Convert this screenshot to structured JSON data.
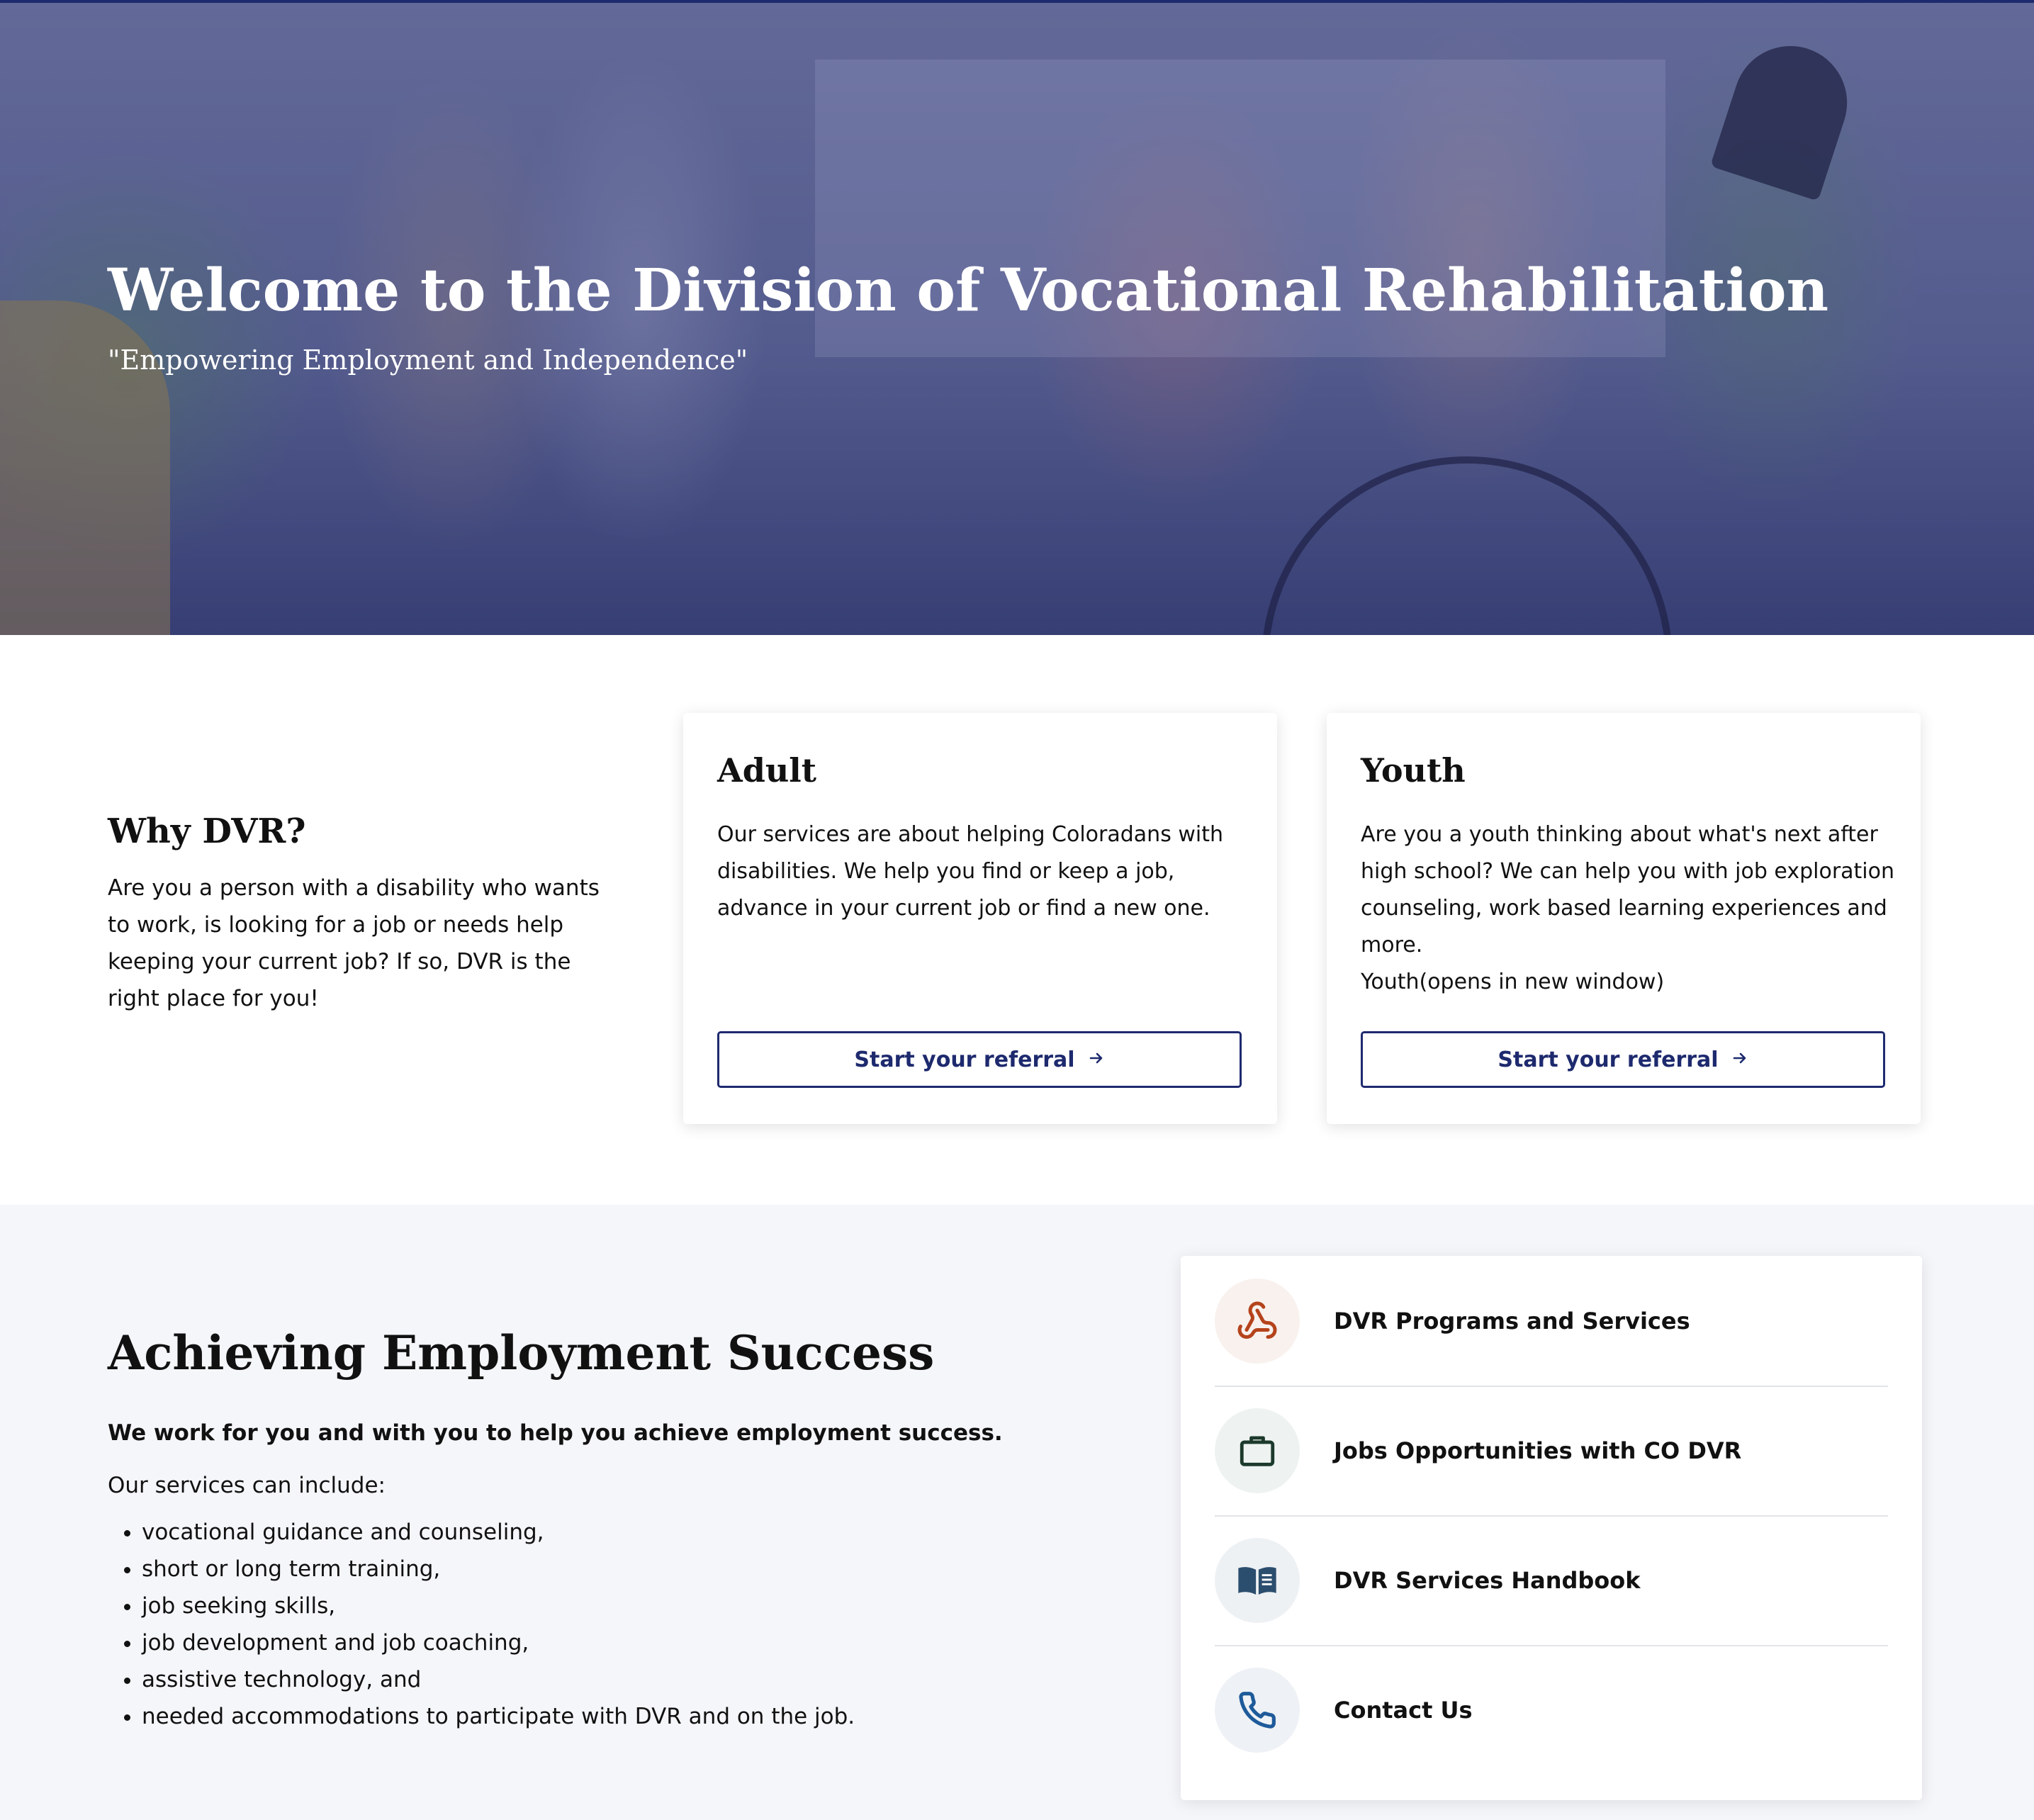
{
  "hero": {
    "title": "Welcome to the Division of Vocational Rehabilitation",
    "subtitle": "\"Empowering Employment and Independence\""
  },
  "why": {
    "heading": "Why DVR?",
    "text": "Are you a person with a disability who wants to work, is looking for a job or needs help keeping your current job? If so, DVR is the right place for you!"
  },
  "cards": [
    {
      "title": "Adult",
      "text": "Our services are about helping Coloradans with disabilities. We help you find or keep a job, advance in your current job or find a new one.",
      "button_label": "Start your referral"
    },
    {
      "title": "Youth",
      "text": "Are you a youth thinking about what's next after high school? We can help you with job exploration counseling, work based learning experiences and more.",
      "link_text": "Youth(opens in new window)",
      "button_label": "Start your referral"
    }
  ],
  "achieving": {
    "heading": "Achieving Employment Success",
    "lead": "We work for you and with you to help you achieve employment success.",
    "intro": "Our services can include:",
    "services": [
      "vocational guidance and counseling,",
      "short or long term training,",
      "job seeking skills,",
      "job development and job coaching,",
      "assistive technology, and",
      "needed accommodations to participate with DVR and on the job."
    ]
  },
  "quick_links": [
    {
      "label": "DVR Programs and Services",
      "icon": "webhook-icon",
      "color": "#b5431b",
      "bg": "#f8f1ee"
    },
    {
      "label": "Jobs Opportunities with CO DVR",
      "icon": "briefcase-icon",
      "color": "#1c3a2c",
      "bg": "#eef3f1"
    },
    {
      "label": "DVR Services Handbook",
      "icon": "book-icon",
      "color": "#2c4e6e",
      "bg": "#eef1f4"
    },
    {
      "label": "Contact Us",
      "icon": "phone-icon",
      "color": "#1d5a9a",
      "bg": "#eef1f5"
    }
  ],
  "colors": {
    "brand_navy": "#1e2a6e",
    "section_bg": "#f5f6fa"
  }
}
